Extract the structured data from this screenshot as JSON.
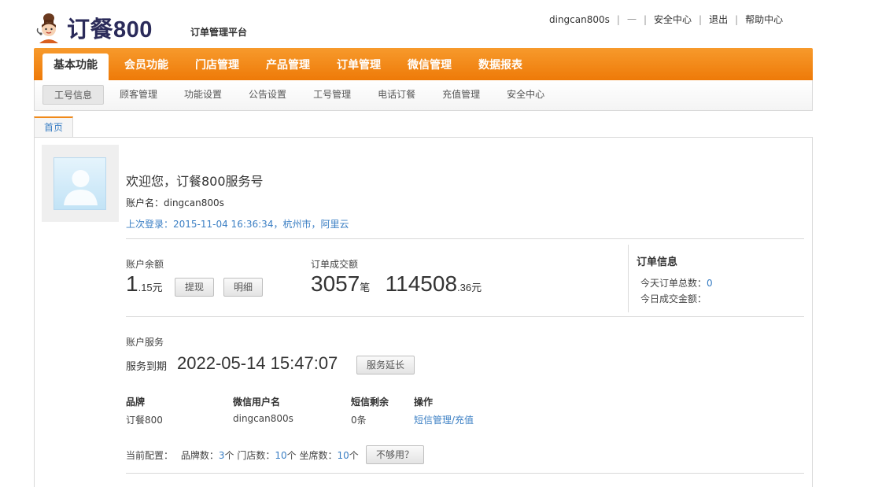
{
  "header": {
    "logo_text": "订餐800",
    "platform_title": "订单管理平台",
    "username": "dingcan800s",
    "separator_dash": "一",
    "links": [
      "安全中心",
      "退出",
      "帮助中心"
    ]
  },
  "main_nav": {
    "items": [
      "基本功能",
      "会员功能",
      "门店管理",
      "产品管理",
      "订单管理",
      "微信管理",
      "数据报表"
    ],
    "active_index": 0
  },
  "sub_nav": {
    "items": [
      "工号信息",
      "顾客管理",
      "功能设置",
      "公告设置",
      "工号管理",
      "电话订餐",
      "充值管理",
      "安全中心"
    ],
    "active_index": 0
  },
  "home_tab": "首页",
  "profile": {
    "welcome": "欢迎您，订餐800服务号",
    "account_name": "账户名：dingcan800s",
    "last_login": "上次登录：2015-11-04 16:36:34，杭州市，阿里云"
  },
  "balance": {
    "label": "账户余额",
    "int": "1",
    "dec": ".15元",
    "withdraw_label": "提现",
    "detail_label": "明细"
  },
  "orders_total": {
    "label": "订单成交额",
    "count": "3057",
    "count_unit": "笔",
    "amount_int": "114508",
    "amount_dec": ".36元"
  },
  "order_info": {
    "title": "订单信息",
    "today_total_label": "今天订单总数：",
    "today_total_value": "0",
    "today_amount_label": "今日成交金额："
  },
  "service": {
    "section_label": "账户服务",
    "expire_label": "服务到期",
    "expire_value": "2022-05-14 15:47:07",
    "extend_label": "服务延长"
  },
  "table": {
    "headers": [
      "品牌",
      "微信用户名",
      "短信剩余",
      "操作"
    ],
    "row": [
      "订餐800",
      "dingcan800s",
      "0条",
      "短信管理/充值"
    ]
  },
  "config": {
    "label": "当前配置：",
    "brand_label": "品牌数：",
    "brand_value": "3",
    "brand_unit": "个",
    "store_label": "门店数：",
    "store_value": "10",
    "store_unit": "个",
    "seat_label": "坐席数：",
    "seat_value": "10",
    "seat_unit": "个",
    "not_enough_label": "不够用？"
  },
  "colors": {
    "nav_orange": "#ee7a08",
    "link_blue": "#3b7fc4",
    "logo_navy": "#2b2b5a"
  }
}
